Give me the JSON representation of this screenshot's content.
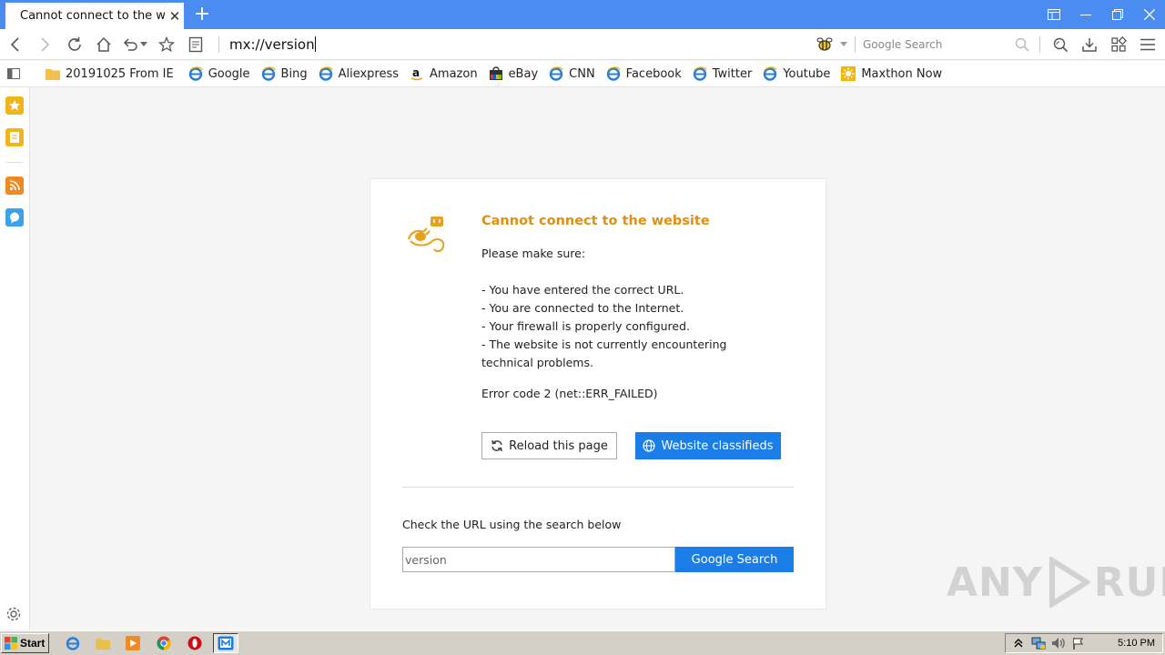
{
  "tab": {
    "title": "Cannot connect to the web",
    "close": "✕",
    "new_tab": "+"
  },
  "window_buttons": [
    "sidebar-layout-icon",
    "minimize-icon",
    "restore-icon",
    "close-icon"
  ],
  "navbar": {
    "address": "mx://version",
    "search_placeholder": "Google Search"
  },
  "bookmarks": [
    {
      "label": "20191025 From IE",
      "icon": "folder-icon"
    },
    {
      "label": "Google",
      "icon": "ie-icon"
    },
    {
      "label": "Bing",
      "icon": "ie-icon"
    },
    {
      "label": "Aliexpress",
      "icon": "ie-icon"
    },
    {
      "label": "Amazon",
      "icon": "amazon-icon"
    },
    {
      "label": "eBay",
      "icon": "ebay-icon"
    },
    {
      "label": "CNN",
      "icon": "ie-icon"
    },
    {
      "label": "Facebook",
      "icon": "ie-icon"
    },
    {
      "label": "Twitter",
      "icon": "ie-icon"
    },
    {
      "label": "Youtube",
      "icon": "ie-icon"
    },
    {
      "label": "Maxthon Now",
      "icon": "maxthon-now-icon"
    }
  ],
  "error": {
    "title": "Cannot connect to the website",
    "make_sure": "Please make sure:",
    "items": [
      "- You have entered the correct URL.",
      "- You are connected to the Internet.",
      "- Your firewall is properly configured.",
      "- The website is not currently encountering technical problems."
    ],
    "code": "Error code 2 (net::ERR_FAILED)",
    "reload_label": "Reload this page",
    "classified_label": "Website classifieds",
    "check_url": "Check the URL using the search below",
    "search_value": "version",
    "search_button": "Google Search"
  },
  "watermark": {
    "left": "ANY",
    "right": "RUN"
  },
  "taskbar": {
    "start_label": "Start",
    "clock": "5:10 PM"
  },
  "colors": {
    "tabbar": "#4a8cf0",
    "error_title": "#e0900f",
    "primary_button": "#1a7ee6"
  }
}
